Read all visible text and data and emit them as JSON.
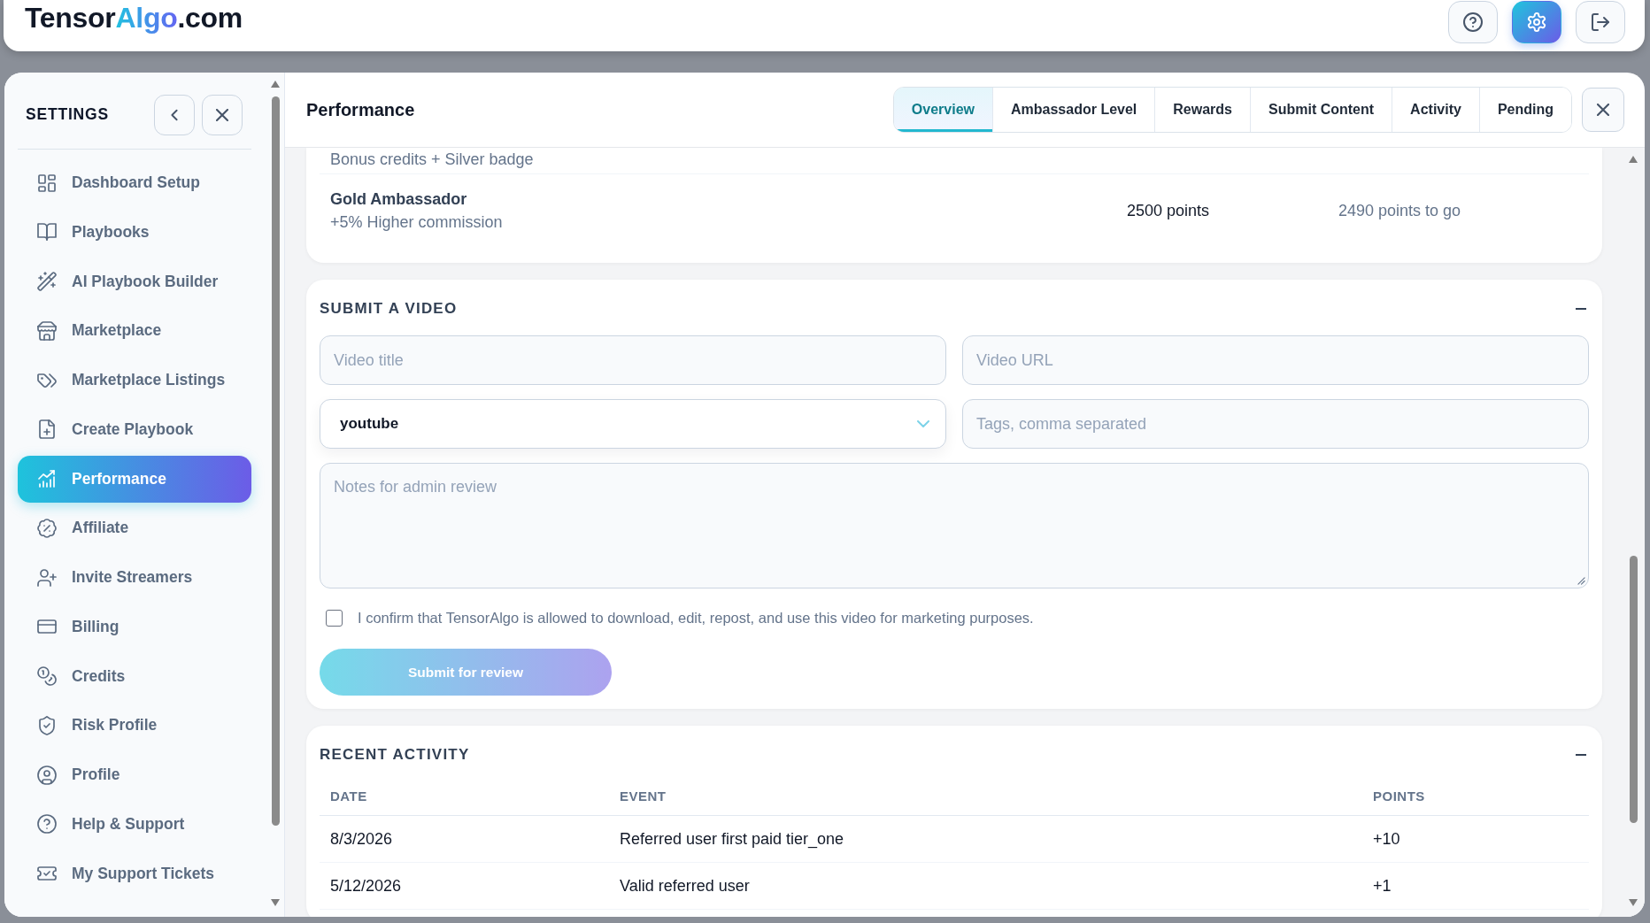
{
  "header": {
    "logo": [
      {
        "text": "Tensor",
        "kind": "plain"
      },
      {
        "text": "Algo",
        "kind": "accent"
      },
      {
        "text": ".com",
        "kind": "plain"
      }
    ],
    "buttons": [
      {
        "kind": "help",
        "selected": false
      },
      {
        "kind": "settings",
        "selected": true
      },
      {
        "kind": "logout",
        "selected": false
      }
    ]
  },
  "sidebar": {
    "title": "SETTINGS",
    "items": [
      {
        "kind": "dashboard",
        "label": "Dashboard Setup",
        "selected": false
      },
      {
        "kind": "book",
        "label": "Playbooks",
        "selected": false
      },
      {
        "kind": "wand",
        "label": "AI Playbook Builder",
        "selected": false
      },
      {
        "kind": "store",
        "label": "Marketplace",
        "selected": false
      },
      {
        "kind": "tags",
        "label": "Marketplace Listings",
        "selected": false
      },
      {
        "kind": "file-plus",
        "label": "Create Playbook",
        "selected": false
      },
      {
        "kind": "chart",
        "label": "Performance",
        "selected": true
      },
      {
        "kind": "percent",
        "label": "Affiliate",
        "selected": false
      },
      {
        "kind": "user-plus",
        "label": "Invite Streamers",
        "selected": false
      },
      {
        "kind": "card",
        "label": "Billing",
        "selected": false
      },
      {
        "kind": "coins",
        "label": "Credits",
        "selected": false
      },
      {
        "kind": "shield",
        "label": "Risk Profile",
        "selected": false
      },
      {
        "kind": "user",
        "label": "Profile",
        "selected": false
      },
      {
        "kind": "help",
        "label": "Help & Support",
        "selected": false
      },
      {
        "kind": "ticket",
        "label": "My Support Tickets",
        "selected": false
      }
    ]
  },
  "panel": {
    "title": "Performance",
    "tabs": [
      {
        "label": "Overview",
        "selected": true
      },
      {
        "label": "Ambassador Level",
        "selected": false
      },
      {
        "label": "Rewards",
        "selected": false
      },
      {
        "label": "Submit Content",
        "selected": false
      },
      {
        "label": "Activity",
        "selected": false
      },
      {
        "label": "Pending",
        "selected": false
      }
    ],
    "levels": [
      {
        "description": "Bonus credits + Silver badge"
      },
      {
        "name": "Gold Ambassador",
        "description": "+5% Higher commission",
        "points": "2500 points",
        "remaining": "2490 points to go"
      }
    ],
    "submit_video": {
      "title": "SUBMIT A VIDEO",
      "video_title": {
        "placeholder": "Video title"
      },
      "video_url": {
        "placeholder": "Video URL"
      },
      "platform": {
        "value": "youtube"
      },
      "tags": {
        "placeholder": "Tags, comma separated"
      },
      "notes": {
        "placeholder": "Notes for admin review"
      },
      "consent": {
        "label": "I confirm that TensorAlgo is allowed to download, edit, repost, and use this video for marketing purposes.",
        "checked": false
      },
      "submit_button": {
        "label": "Submit for review",
        "disabled": true
      }
    },
    "recent_activity": {
      "title": "RECENT ACTIVITY",
      "columns": [
        "DATE",
        "EVENT",
        "POINTS"
      ],
      "rows": [
        [
          "8/3/2026",
          "Referred user first paid tier_one",
          "+10"
        ],
        [
          "5/12/2026",
          "Valid referred user",
          "+1"
        ]
      ]
    }
  }
}
